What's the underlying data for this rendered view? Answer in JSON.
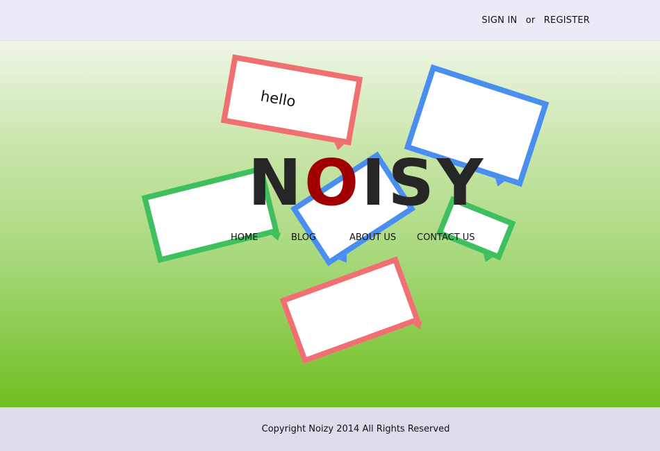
{
  "header": {
    "sign_in": "SIGN IN",
    "or": "or",
    "register": "REGISTER"
  },
  "hero": {
    "bubble_text": "hello",
    "logo": {
      "before": "N",
      "highlight": "O",
      "after": "ISY"
    },
    "nav": [
      "HOME",
      "BLOG",
      "ABOUT US",
      "CONTACT US"
    ]
  },
  "footer": {
    "copyright": "Copyright Noizy 2014 All Rights Reserved"
  },
  "colors": {
    "red_bubble": "#f07072",
    "blue_bubble": "#4a8ff0",
    "green_bubble": "#3fbf5d",
    "logo_dark": "#262626",
    "logo_accent": "#a00000",
    "gradient_top": "#eef6e6",
    "gradient_bottom": "#6fbe20"
  }
}
